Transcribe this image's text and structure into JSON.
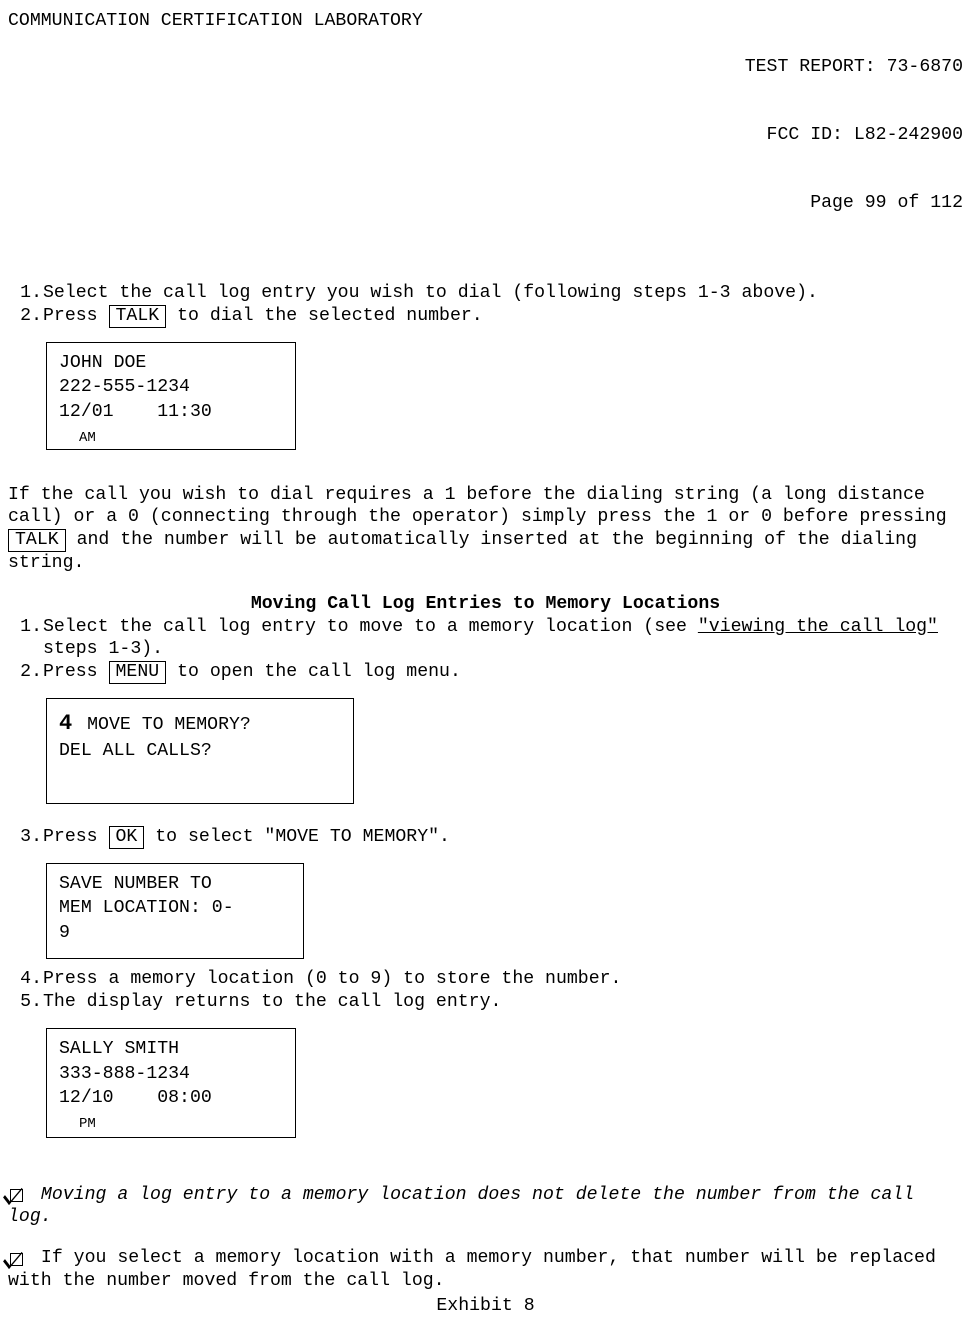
{
  "header": {
    "left": "COMMUNICATION CERTIFICATION LABORATORY",
    "r1": "TEST REPORT: 73-6870",
    "r2": "FCC ID: L82-242900",
    "r3": "Page 99 of 112"
  },
  "steps_a": {
    "n1": "1.",
    "t1": "Select the call log entry you wish to dial (following steps 1-3 above).",
    "n2": "2.",
    "t2a": "Press ",
    "t2key": " TALK ",
    "t2b": " to dial the selected number."
  },
  "screen1": {
    "l1": "JOHN DOE",
    "l2": "222-555-1234",
    "l3": "12/01    11:30",
    "l4": "AM"
  },
  "para1a": "If the call you wish to dial requires a 1 before the dialing string (a long distance call) or a 0 (connecting through the operator) simply press the 1 or 0 before pressing ",
  "para1key": "TALK",
  "para1b": " and the number will be automatically inserted at the beginning of the dialing string.",
  "section_title": "Moving Call Log Entries to Memory Locations",
  "steps_b": {
    "n1": "1.",
    "t1a": "Select the call log entry to move to a memory location (see ",
    "t1b": "\"viewing the call log\"",
    "t1c": " steps 1-3).",
    "n2": "2.",
    "t2a": "Press ",
    "t2key": " MENU ",
    "t2b": " to open the call log menu."
  },
  "screen2": {
    "big": "4",
    "l1": " MOVE TO MEMORY?",
    "l2": "DEL ALL CALLS?"
  },
  "steps_c": {
    "n3": "3.",
    "t3a": "Press ",
    "t3key": " OK ",
    "t3b": " to select \"MOVE TO MEMORY\"."
  },
  "screen3": {
    "l1": "SAVE NUMBER TO",
    "l2": "MEM LOCATION: 0-",
    "l3": "9"
  },
  "steps_d": {
    "n4": "4.",
    "t4": "Press a memory location (0 to 9) to store the number.",
    "n5": "5.",
    "t5": "The display returns to the call log entry."
  },
  "screen4": {
    "l1": "SALLY SMITH",
    "l2": "333-888-1234",
    "l3": "12/10    08:00",
    "l4": "PM"
  },
  "note1": " Moving a log entry to a memory location does not delete the number from the call log.",
  "note2": " If you select a memory location with a memory number, that number will be replaced with the number moved from the call log.",
  "footer": "Exhibit 8"
}
